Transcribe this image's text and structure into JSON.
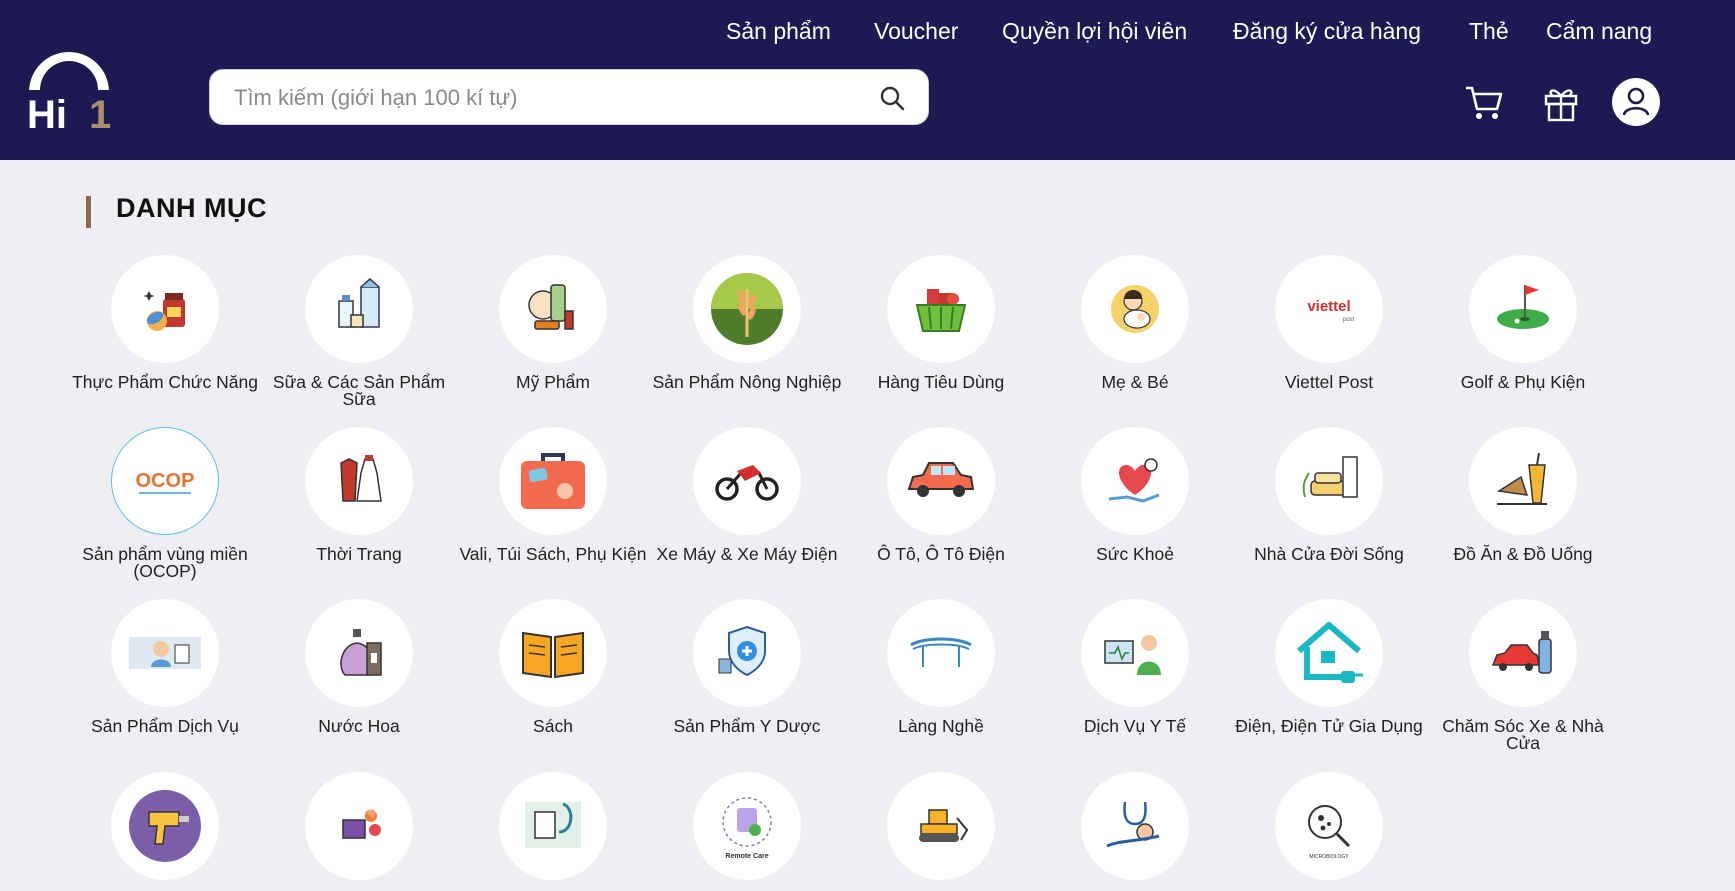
{
  "brand": {
    "logo_text": "Hi",
    "logo_number": "1",
    "accent": "#8b6b4f",
    "header_bg": "#1d1a53"
  },
  "nav": [
    "Sản phẩm",
    "Voucher",
    "Quyền lợi hội viên",
    "Đăng ký cửa hàng",
    "Thẻ",
    "Cẩm nang"
  ],
  "search": {
    "placeholder": "Tìm kiếm (giới hạn 100 kí tự)",
    "value": ""
  },
  "header_icons": [
    "cart-icon",
    "gift-icon",
    "user-icon"
  ],
  "section": {
    "title": "DANH MỤC"
  },
  "categories": [
    {
      "label": "Thực Phẩm Chức Năng",
      "icon": "supplement-icon"
    },
    {
      "label": "Sữa & Các Sản Phẩm Sữa",
      "icon": "milk-icon"
    },
    {
      "label": "Mỹ Phẩm",
      "icon": "cosmetics-icon"
    },
    {
      "label": "Sản Phẩm Nông Nghiệp",
      "icon": "wheat-icon"
    },
    {
      "label": "Hàng Tiêu Dùng",
      "icon": "basket-icon"
    },
    {
      "label": "Mẹ & Bé",
      "icon": "mother-baby-icon"
    },
    {
      "label": "Viettel Post",
      "icon": "viettel-post-logo",
      "logo_text": "viettel",
      "logo_sub": "post"
    },
    {
      "label": "Golf & Phụ Kiện",
      "icon": "golf-icon"
    },
    {
      "label": "Sản phẩm vùng miền (OCOP)",
      "icon": "ocop-logo",
      "logo_text": "OCOP"
    },
    {
      "label": "Thời Trang",
      "icon": "fashion-icon"
    },
    {
      "label": "Vali, Túi Sách, Phụ Kiện",
      "icon": "suitcase-icon"
    },
    {
      "label": "Xe Máy & Xe Máy Điện",
      "icon": "motorbike-icon"
    },
    {
      "label": "Ô Tô, Ô Tô Điện",
      "icon": "car-icon"
    },
    {
      "label": "Sức Khoẻ",
      "icon": "health-icon"
    },
    {
      "label": "Nhà Cửa Đời Sống",
      "icon": "furniture-icon"
    },
    {
      "label": "Đồ Ăn & Đồ Uống",
      "icon": "food-drink-icon"
    },
    {
      "label": "Sản Phẩm Dịch Vụ",
      "icon": "service-icon"
    },
    {
      "label": "Nước Hoa",
      "icon": "perfume-icon"
    },
    {
      "label": "Sách",
      "icon": "book-icon"
    },
    {
      "label": "Sản Phẩm Y Dược",
      "icon": "pharma-icon"
    },
    {
      "label": "Làng Nghề",
      "icon": "craft-village-icon"
    },
    {
      "label": "Dịch Vụ Y Tế",
      "icon": "medical-service-icon"
    },
    {
      "label": "Điện, Điện Tử Gia Dụng",
      "icon": "smart-home-icon"
    },
    {
      "label": "Chăm Sóc Xe & Nhà Cửa",
      "icon": "cleaning-icon"
    },
    {
      "label": "",
      "icon": "drill-icon"
    },
    {
      "label": "",
      "icon": "flower-gift-icon"
    },
    {
      "label": "",
      "icon": "stethoscope-icon"
    },
    {
      "label": "",
      "icon": "remote-care-icon",
      "logo_text": "Remote Care"
    },
    {
      "label": "",
      "icon": "bulldozer-icon"
    },
    {
      "label": "",
      "icon": "healthcare-hand-icon"
    },
    {
      "label": "",
      "icon": "microbiology-icon",
      "logo_text": "MICROBIOLOGY"
    }
  ]
}
